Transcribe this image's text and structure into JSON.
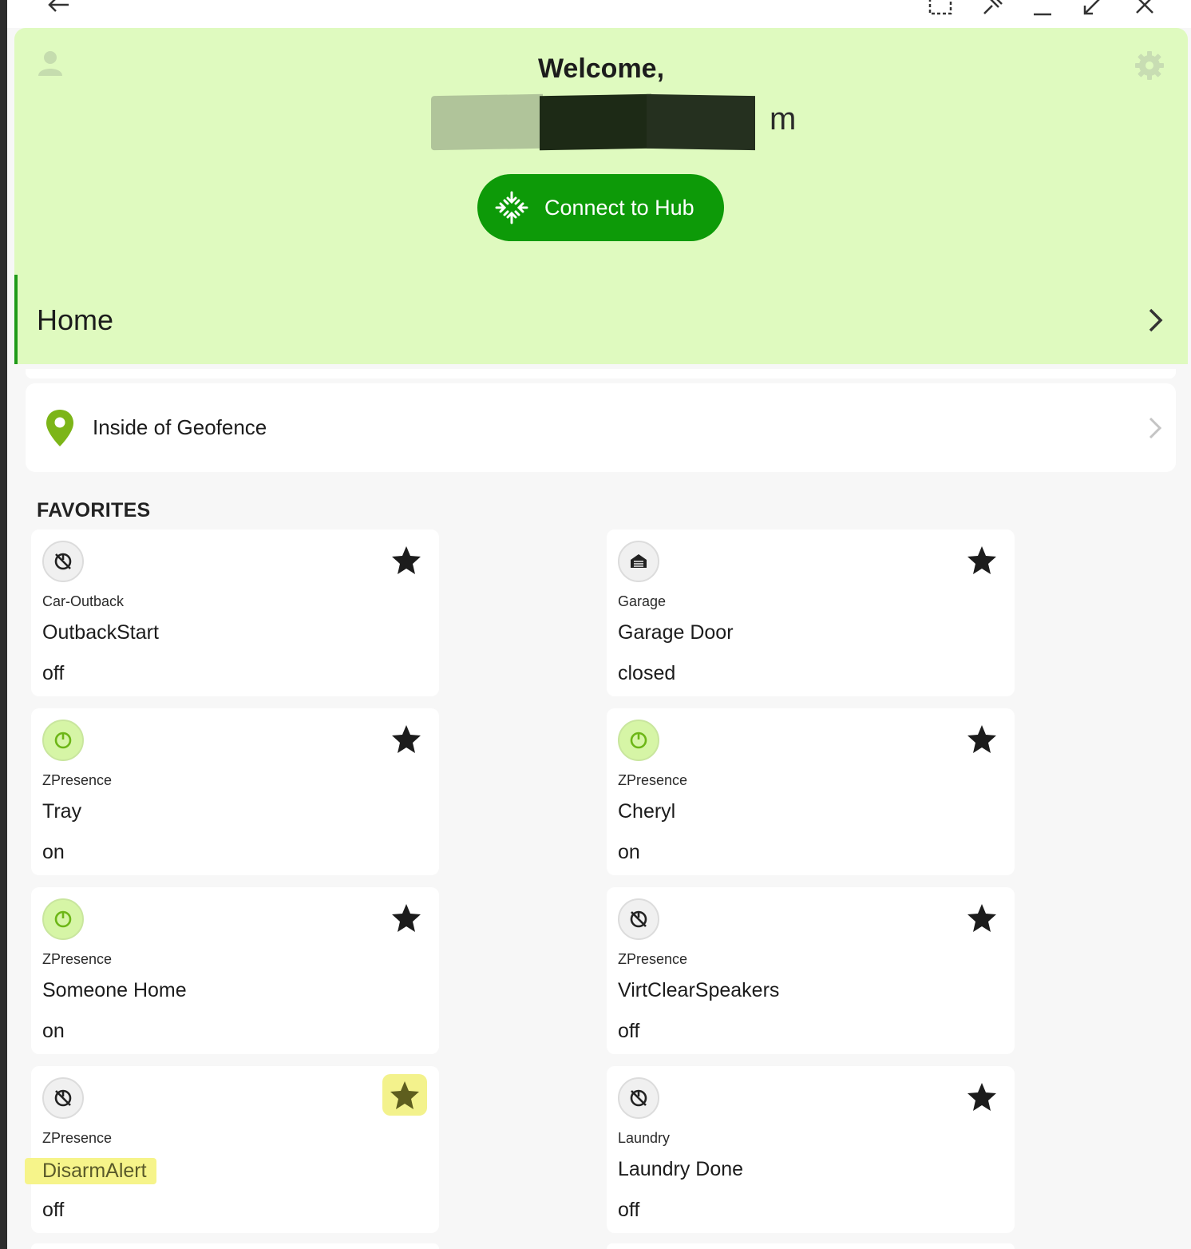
{
  "header": {
    "welcome": "Welcome,",
    "name_suffix": "m",
    "connect_label": "Connect to Hub",
    "nav_label": "Home"
  },
  "geofence": {
    "label": "Inside of Geofence"
  },
  "favorites": {
    "title": "FAVORITES",
    "items": [
      {
        "room": "Car-Outback",
        "name": "OutbackStart",
        "state": "off"
      },
      {
        "room": "Garage",
        "name": "Garage Door",
        "state": "closed"
      },
      {
        "room": "ZPresence",
        "name": "Tray",
        "state": "on"
      },
      {
        "room": "ZPresence",
        "name": "Cheryl",
        "state": "on"
      },
      {
        "room": "ZPresence",
        "name": "Someone Home",
        "state": "on"
      },
      {
        "room": "ZPresence",
        "name": "VirtClearSpeakers",
        "state": "off"
      },
      {
        "room": "ZPresence",
        "name": "DisarmAlert",
        "state": "off"
      },
      {
        "room": "Laundry",
        "name": "Laundry Done",
        "state": "off"
      }
    ]
  },
  "colors": {
    "header_bg": "#dffabf",
    "accent_green": "#0d9a08",
    "pin_green": "#7cb518",
    "highlight_yellow": "#f6f48a"
  },
  "icons": {
    "top_bar": [
      "back-arrow-icon",
      "screenshot-icon",
      "pin-icon",
      "minimize-icon",
      "resize-icon",
      "close-icon"
    ],
    "device_off": "power-off-icon",
    "device_on": "power-on-icon",
    "garage": "garage-icon",
    "favorite": "star-icon"
  }
}
